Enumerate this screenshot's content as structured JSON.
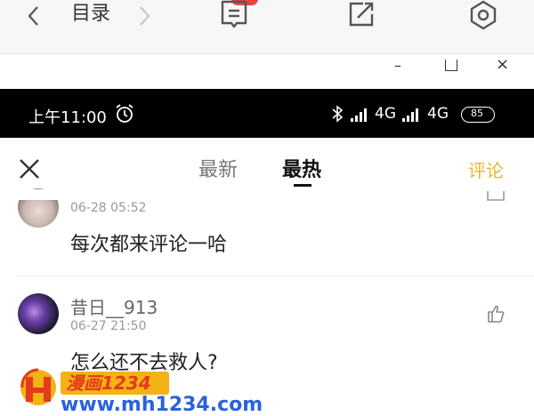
{
  "reader_toolbar": {
    "back_icon": "chevron-left-icon",
    "toc_label": "目录",
    "next_icon": "chevron-right-icon",
    "comment_icon": "comment-list-icon",
    "share_icon": "share-icon",
    "settings_icon": "settings-hexagon-icon"
  },
  "window_controls": {
    "minimize": "–",
    "close": "×"
  },
  "status_bar": {
    "time": "上午11:00",
    "network1": "4G",
    "network2": "4G",
    "battery": "85"
  },
  "comments_header": {
    "tabs": [
      {
        "label": "最新",
        "active": false
      },
      {
        "label": "最热",
        "active": true
      }
    ],
    "write_comment": "评论"
  },
  "comments": [
    {
      "username": "",
      "time": "06-28 05:52",
      "text": "每次都来评论一哈"
    },
    {
      "username": "昔日__913",
      "time": "06-27 21:50",
      "text": "怎么还不去救人?"
    }
  ],
  "watermark": {
    "title": "漫画1234",
    "url": "www.mh1234.com"
  },
  "colors": {
    "accent": "#e4b730",
    "status_bar_bg": "#000000",
    "watermark_blue": "#2a62d8"
  }
}
